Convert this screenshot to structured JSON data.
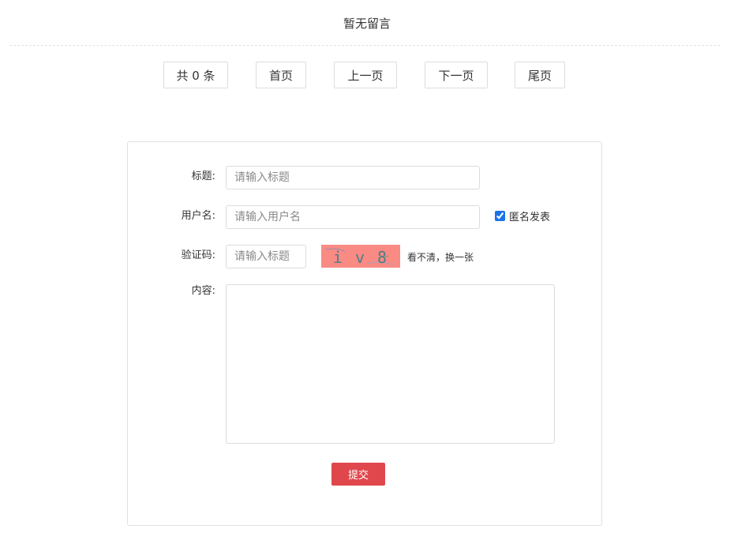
{
  "message_list": {
    "empty_text": "暂无留言"
  },
  "pager": {
    "total_label": "共 0 条",
    "first_label": "首页",
    "prev_label": "上一页",
    "next_label": "下一页",
    "last_label": "尾页"
  },
  "form": {
    "title_label": "标题:",
    "title_placeholder": "请输入标题",
    "username_label": "用户名:",
    "username_placeholder": "请输入用户名",
    "anonymous_label": "匿名发表",
    "anonymous_checked": true,
    "captcha_label": "验证码:",
    "captcha_placeholder": "请输入标题",
    "captcha_text": "s i v 8 r",
    "captcha_refresh_label": "看不清，换一张",
    "content_label": "内容:",
    "submit_label": "提交"
  },
  "colors": {
    "submit_bg": "#e0474c",
    "captcha_bg": "#f98a84",
    "checkbox_accent": "#1a73e8"
  }
}
